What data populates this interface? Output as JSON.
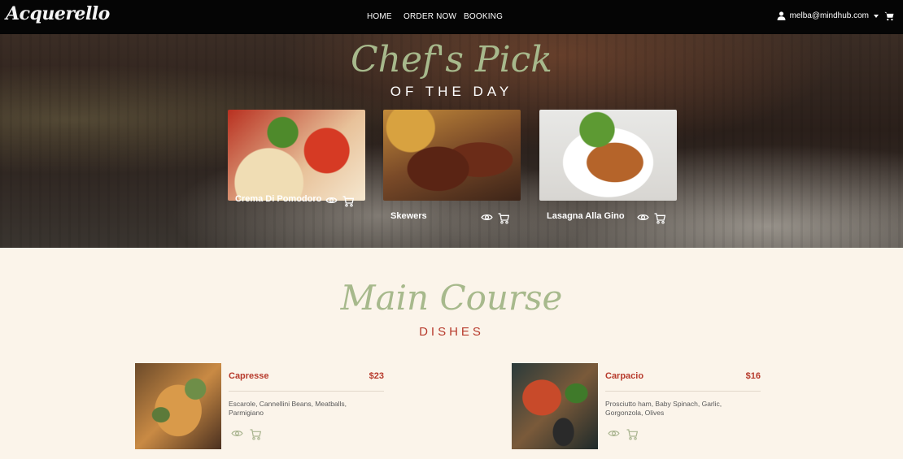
{
  "navbar": {
    "brand": "Acquerello",
    "links": [
      "HOME",
      "ORDER NOW",
      "BOOKING"
    ],
    "user_email": "melba@mindhub.com"
  },
  "hero": {
    "script_title": "Chef's Pick",
    "subtitle": "OF THE DAY",
    "picks": [
      {
        "name": "Crema Di Pomodoro"
      },
      {
        "name": "Skewers"
      },
      {
        "name": "Lasagna Alla Gino"
      }
    ]
  },
  "main_course": {
    "script_title": "Main Course",
    "subtitle": "DISHES",
    "dishes": [
      {
        "name": "Capresse",
        "price": "$23",
        "description": "Escarole, Cannellini Beans, Meatballs, Parmigiano"
      },
      {
        "name": "Carpacio",
        "price": "$16",
        "description": "Prosciutto ham, Baby Spinach, Garlic, Gorgonzola, Olives"
      }
    ]
  },
  "icons": [
    "user-icon",
    "chevron-down-icon",
    "cart-icon",
    "eye-icon"
  ],
  "colors": {
    "navbar_bg": "#050505",
    "script_green": "#a7b98c",
    "accent_red": "#b73a2c",
    "page_bg": "#fbf4ea",
    "muted_icon": "#a9b48f"
  }
}
